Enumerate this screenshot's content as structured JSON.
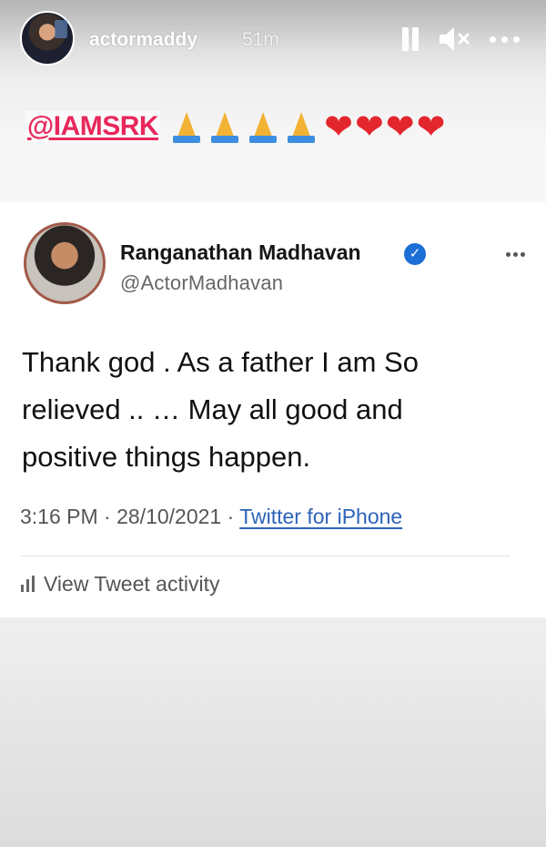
{
  "story": {
    "username": "actormaddy",
    "time_ago": "51m",
    "icons": [
      "pause-icon",
      "mute-icon",
      "more-icon"
    ]
  },
  "caption": {
    "mention": "@IAMSRK",
    "emojis": [
      "folded-hands",
      "folded-hands",
      "folded-hands",
      "folded-hands",
      "red-heart",
      "red-heart",
      "red-heart",
      "red-heart"
    ]
  },
  "tweet": {
    "display_name": "Ranganathan Madhavan",
    "handle": "@ActorMadhavan",
    "verified": true,
    "text": "Thank god . As a father I am So relieved .. … May all good and positive things happen.",
    "timestamp": "3:16 PM · 28/10/2021 · ",
    "source": "Twitter for iPhone",
    "activity_label": "View Tweet activity"
  },
  "colors": {
    "mention": "#e8285c",
    "verified": "#1d6fd8",
    "link": "#2d63b8"
  }
}
